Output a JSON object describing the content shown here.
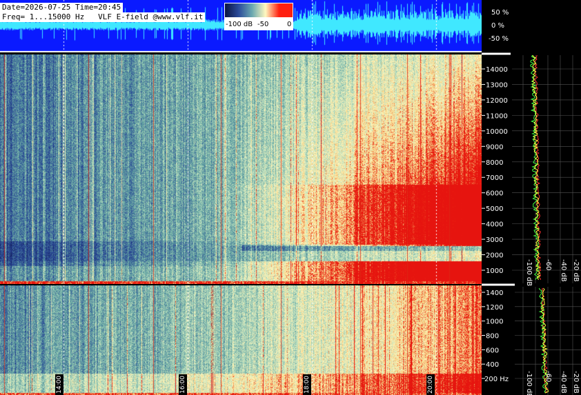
{
  "header": {
    "date_time": "Date=2026-07-25 Time=20:45",
    "freq_line": "Freq= 1...15000 Hz   VLF E-field @www.vlf.it"
  },
  "colorbar": {
    "ticks": [
      "-100 dB",
      "-50",
      "0"
    ],
    "stops": [
      "#0a1440",
      "#2a4a9a",
      "#6aa8b0",
      "#fff8c0",
      "#ff2010",
      "#ff2010"
    ]
  },
  "waveform": {
    "ticks": [
      "50 %",
      "0 %",
      "-50 %"
    ],
    "colors": {
      "background": "#0a1aff",
      "signal": "#40e8ff"
    }
  },
  "upper_panel": {
    "freq_ticks": [
      "14000",
      "13000",
      "12000",
      "11000",
      "10000",
      "9000",
      "8000",
      "7000",
      "6000",
      "5000",
      "4000",
      "3000",
      "2000",
      "1000"
    ],
    "db_ticks": [
      "-100 dB",
      "-60",
      "-40 dB",
      "-20 dB"
    ]
  },
  "lower_panel": {
    "freq_ticks": [
      "1400",
      "1200",
      "1000",
      "800",
      "600",
      "400",
      "200 Hz"
    ],
    "db_ticks": [
      "-100 dB",
      "-60",
      "-40 dB",
      "-20 dB"
    ]
  },
  "time_labels": [
    "14:00",
    "16:00",
    "18:00",
    "20:00"
  ],
  "colors": {
    "deep_blue": "#1e3a8a",
    "teal": "#6aa8a0",
    "light_green": "#c8e6c0",
    "cream": "#fff0b0",
    "red": "#e81a10",
    "line_yellow": "#ffff40",
    "line_green": "#40ff40",
    "line_red": "#ff3030"
  },
  "chart_data": {
    "type": "heatmap",
    "title": "VLF E-field @www.vlf.it",
    "x_label_ticks": [
      "14:00",
      "16:00",
      "18:00",
      "20:00"
    ],
    "upper_y_range_hz": [
      1,
      15000
    ],
    "lower_y_range_hz": [
      1,
      1500
    ],
    "color_scale_db": [
      -100,
      0
    ],
    "description_of_trend": "deep blue (quiet) early in the session, increasing to red (strong) intensity in 1000-6000 Hz after 18:00"
  }
}
